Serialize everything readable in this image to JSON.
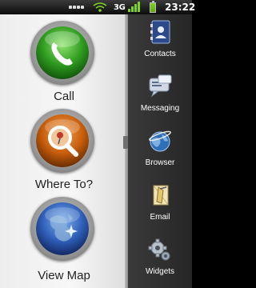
{
  "status_bar": {
    "network": "3G",
    "time": "23:22",
    "icons": [
      "notification-icon",
      "wifi-tethering-icon",
      "signal-icon",
      "battery-icon"
    ]
  },
  "main": {
    "tiles": [
      {
        "label": "Call",
        "icon": "phone-icon",
        "color": "#2e9a1f"
      },
      {
        "label": "Where To?",
        "icon": "search-pin-icon",
        "color": "#d26a10"
      },
      {
        "label": "View Map",
        "icon": "map-globe-icon",
        "color": "#2f5fb8"
      }
    ]
  },
  "dock": {
    "items": [
      {
        "label": "Contacts",
        "icon": "contacts-icon"
      },
      {
        "label": "Messaging",
        "icon": "messaging-icon"
      },
      {
        "label": "Browser",
        "icon": "browser-icon"
      },
      {
        "label": "Email",
        "icon": "email-icon"
      },
      {
        "label": "Widgets",
        "icon": "widgets-icon"
      }
    ]
  }
}
